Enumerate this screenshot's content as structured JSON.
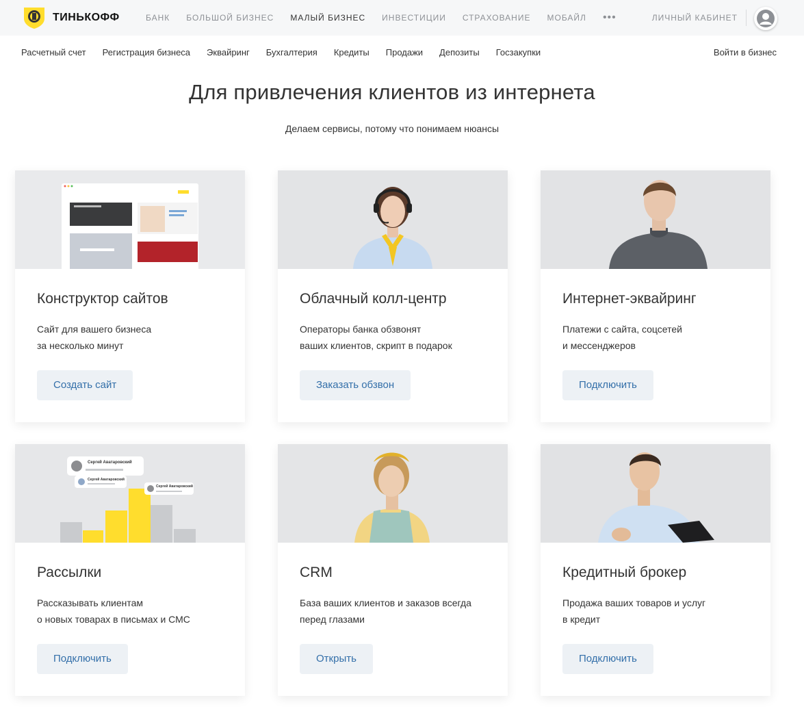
{
  "header": {
    "logo_text": "ТИНЬКОФФ",
    "nav": [
      "БАНК",
      "БОЛЬШОЙ БИЗНЕС",
      "МАЛЫЙ БИЗНЕС",
      "ИНВЕСТИЦИИ",
      "СТРАХОВАНИЕ",
      "МОБАЙЛ"
    ],
    "active_nav": "МАЛЫЙ БИЗНЕС",
    "more": "•••",
    "cabinet": "ЛИЧНЫЙ КАБИНЕТ"
  },
  "subnav": {
    "items": [
      "Расчетный счет",
      "Регистрация бизнеса",
      "Эквайринг",
      "Бухгалтерия",
      "Кредиты",
      "Продажи",
      "Депозиты",
      "Госзакупки"
    ],
    "login": "Войти в бизнес"
  },
  "main": {
    "title": "Для привлечения клиентов из интернета",
    "subtitle": "Делаем сервисы, потому что понимаем нюансы",
    "cards": [
      {
        "title": "Конструктор сайтов",
        "desc": [
          "Сайт для вашего бизнеса",
          "за несколько минут"
        ],
        "button": "Создать сайт",
        "image": "website-builder-preview"
      },
      {
        "title": "Облачный колл-центр",
        "desc": [
          "Операторы банка обзвонят",
          "ваших клиентов, скрипт в подарок"
        ],
        "button": "Заказать обзвон",
        "image": "operator-with-headset-photo"
      },
      {
        "title": "Интернет-эквайринг",
        "desc": [
          "Платежи с сайта, соцсетей",
          "и мессенджеров"
        ],
        "button": "Подключить",
        "image": "man-in-sweater-photo"
      },
      {
        "title": "Рассылки",
        "desc": [
          "Рассказывать клиентам",
          "о новых товарах в письмах и СМС"
        ],
        "button": "Подключить",
        "image": "mailing-bar-graphic",
        "image_text": {
          "sender_name": "Сергей Аватаровский"
        }
      },
      {
        "title": "CRM",
        "desc": [
          "База ваших клиентов и заказов всегда",
          "перед глазами"
        ],
        "button": "Открыть",
        "image": "woman-in-apron-photo"
      },
      {
        "title": "Кредитный брокер",
        "desc": [
          "Продажа ваших товаров и услуг",
          "в кредит"
        ],
        "button": "Подключить",
        "image": "man-with-clipboard-photo"
      }
    ]
  },
  "colors": {
    "topbar_bg": "#f6f7f8",
    "button_bg": "#edf1f5",
    "button_text": "#336fa9",
    "accent_yellow": "#ffdd2d",
    "card_image_bg": "#e7e8ea"
  }
}
